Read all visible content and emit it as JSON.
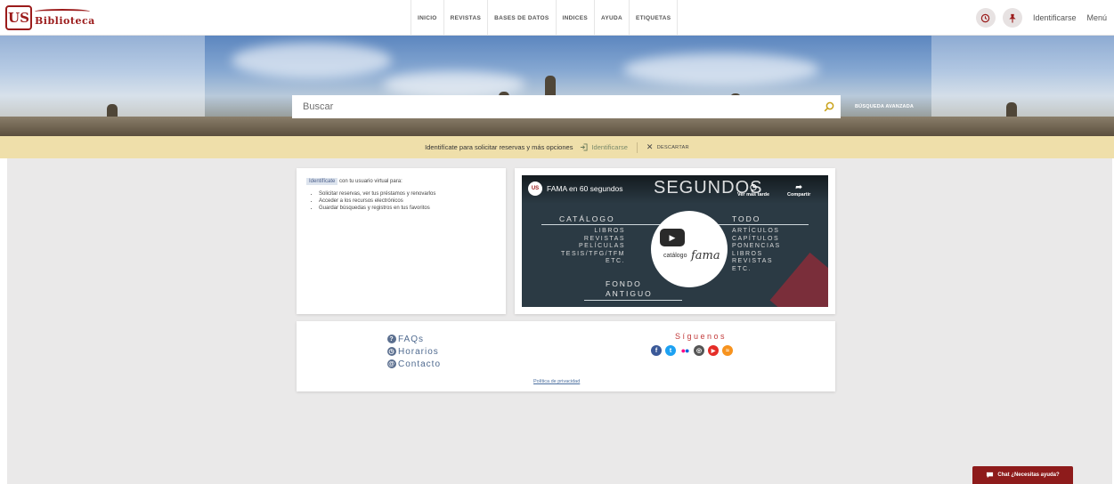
{
  "header": {
    "logo_text": "Biblioteca",
    "nav": [
      "INICIO",
      "REVISTAS",
      "BASES DE DATOS",
      "INDICES",
      "AYUDA",
      "ETIQUETAS"
    ],
    "identify_label": "Identificarse",
    "menu_label": "Menú",
    "icons": [
      "history-icon",
      "pin-icon"
    ]
  },
  "search": {
    "placeholder": "Buscar",
    "advanced_label": "BÚSQUEDA AVANZADA"
  },
  "banner": {
    "message": "Identifícate para solicitar reservas y más opciones",
    "identify_label": "Identificarse",
    "discard_label": "DESCARTAR"
  },
  "info_card": {
    "badge": "Identifícate",
    "intro": "con tu usuario virtual para:",
    "items": [
      "Solicitar reservas, ver tus préstamos y renovarlos",
      "Acceder a los recursos electrónicos",
      "Guardar búsquedas y registros en tus favoritos"
    ]
  },
  "video": {
    "title": "FAMA en 60 segundos",
    "overlay_big": "SEGUNDOS",
    "watch_later": "Ver más tarde",
    "share": "Compartir",
    "catalogo_head": "CATÁLOGO",
    "catalogo_items": [
      "LIBROS",
      "REVISTAS",
      "PELÍCULAS",
      "TESIS/TFG/TFM",
      "ETC."
    ],
    "todo_head": "TODO",
    "todo_items": [
      "ARTÍCULOS",
      "CAPÍTULOS",
      "PONENCIAS",
      "LIBROS",
      "REVISTAS",
      "ETC."
    ],
    "fondo_head": "FONDO",
    "fondo_head2": "ANTIGUO",
    "brand_small": "catálogo",
    "brand_script": "fama"
  },
  "footer": {
    "links": [
      "FAQs",
      "Horarios",
      "Contacto"
    ],
    "follow_label": "Síguenos",
    "social": [
      {
        "name": "facebook-icon",
        "color": "#3b5998",
        "glyph": "f"
      },
      {
        "name": "twitter-icon",
        "color": "#1da1f2",
        "glyph": "t"
      },
      {
        "name": "flickr-icon",
        "color": "#ff0084",
        "glyph": "••"
      },
      {
        "name": "instagram-icon",
        "color": "#555555",
        "glyph": "◎"
      },
      {
        "name": "youtube-icon",
        "color": "#e52d27",
        "glyph": "▶"
      },
      {
        "name": "rss-icon",
        "color": "#f7931e",
        "glyph": "≈"
      }
    ],
    "privacy_label": "Política de privacidad"
  },
  "chat": {
    "label": "Chat ¿Necesitas ayuda?"
  },
  "colors": {
    "brand": "#9b1b1b",
    "banner_bg": "#efdfaa",
    "main_bg": "#eae9e9",
    "chat_bg": "#8e1b1b"
  }
}
